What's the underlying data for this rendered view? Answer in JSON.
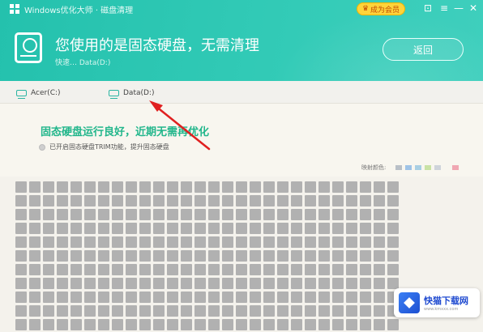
{
  "window": {
    "title": "Windows优化大师",
    "title_extra": "· 磁盘清理",
    "member_label": "成为会员",
    "minimize": "—",
    "close": "✕",
    "skin": "⊡",
    "menu": "≡"
  },
  "header": {
    "headline": "您使用的是固态硬盘，无需清理",
    "subline": "快速… Data(D:)",
    "back_label": "返回"
  },
  "tabs": [
    {
      "label": "Acer(C:)"
    },
    {
      "label": "Data(D:)"
    }
  ],
  "status": {
    "title": "固态硬盘运行良好，近期无需再优化",
    "note": "已开启固态硬盘TRIM功能，提升固态硬盘"
  },
  "legend": {
    "label": "映射颜色:",
    "colors": [
      "#b9c0c7",
      "#9fc3e6",
      "#a9cfe3",
      "#c9e2a5",
      "#cfd4da",
      "#f0a7b2"
    ]
  },
  "block_grid": {
    "rows": 11,
    "cols": 28,
    "color": "#b1b1b1"
  },
  "watermark": {
    "name": "快猫下载网",
    "url": "www.kmxxx.com"
  }
}
